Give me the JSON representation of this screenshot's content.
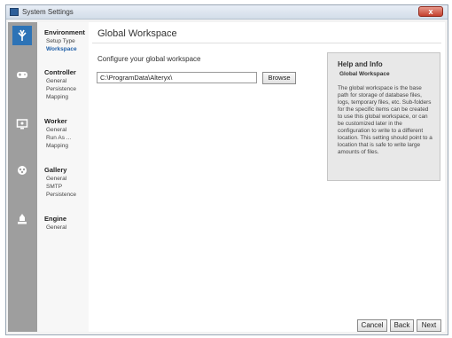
{
  "window": {
    "title": "System Settings",
    "close_label": "x"
  },
  "nav": [
    {
      "heading": "Environment",
      "items": [
        "Setup Type",
        "Workspace"
      ],
      "active_item": 1
    },
    {
      "heading": "Controller",
      "items": [
        "General",
        "Persistence",
        "Mapping"
      ],
      "active_item": -1
    },
    {
      "heading": "Worker",
      "items": [
        "General",
        "Run As ...",
        "Mapping"
      ],
      "active_item": -1
    },
    {
      "heading": "Gallery",
      "items": [
        "General",
        "SMTP",
        "Persistence"
      ],
      "active_item": -1
    },
    {
      "heading": "Engine",
      "items": [
        "General"
      ],
      "active_item": -1
    }
  ],
  "sidebar_icons": [
    "leaf-icon",
    "gamepad-icon",
    "monitor-icon",
    "gallery-icon",
    "engine-icon"
  ],
  "main": {
    "title": "Global Workspace",
    "config_label": "Configure your global workspace",
    "path_value": "C:\\ProgramData\\Alteryx\\",
    "browse_label": "Browse"
  },
  "help": {
    "heading": "Help and Info",
    "subheading": "Global Workspace",
    "body": "The global workspace is the base path for storage of database files, logs, temporary files, etc. Sub-folders for the specific items can be created to use this global workspace, or can be customized later in the configuration to write to a different location. This setting should point to a location that is safe to write large amounts of files."
  },
  "footer": {
    "cancel_label": "Cancel",
    "back_label": "Back",
    "next_label": "Next"
  },
  "colors": {
    "accent": "#2d73b6",
    "sidebar": "#9e9e9e",
    "close": "#c4402d"
  }
}
